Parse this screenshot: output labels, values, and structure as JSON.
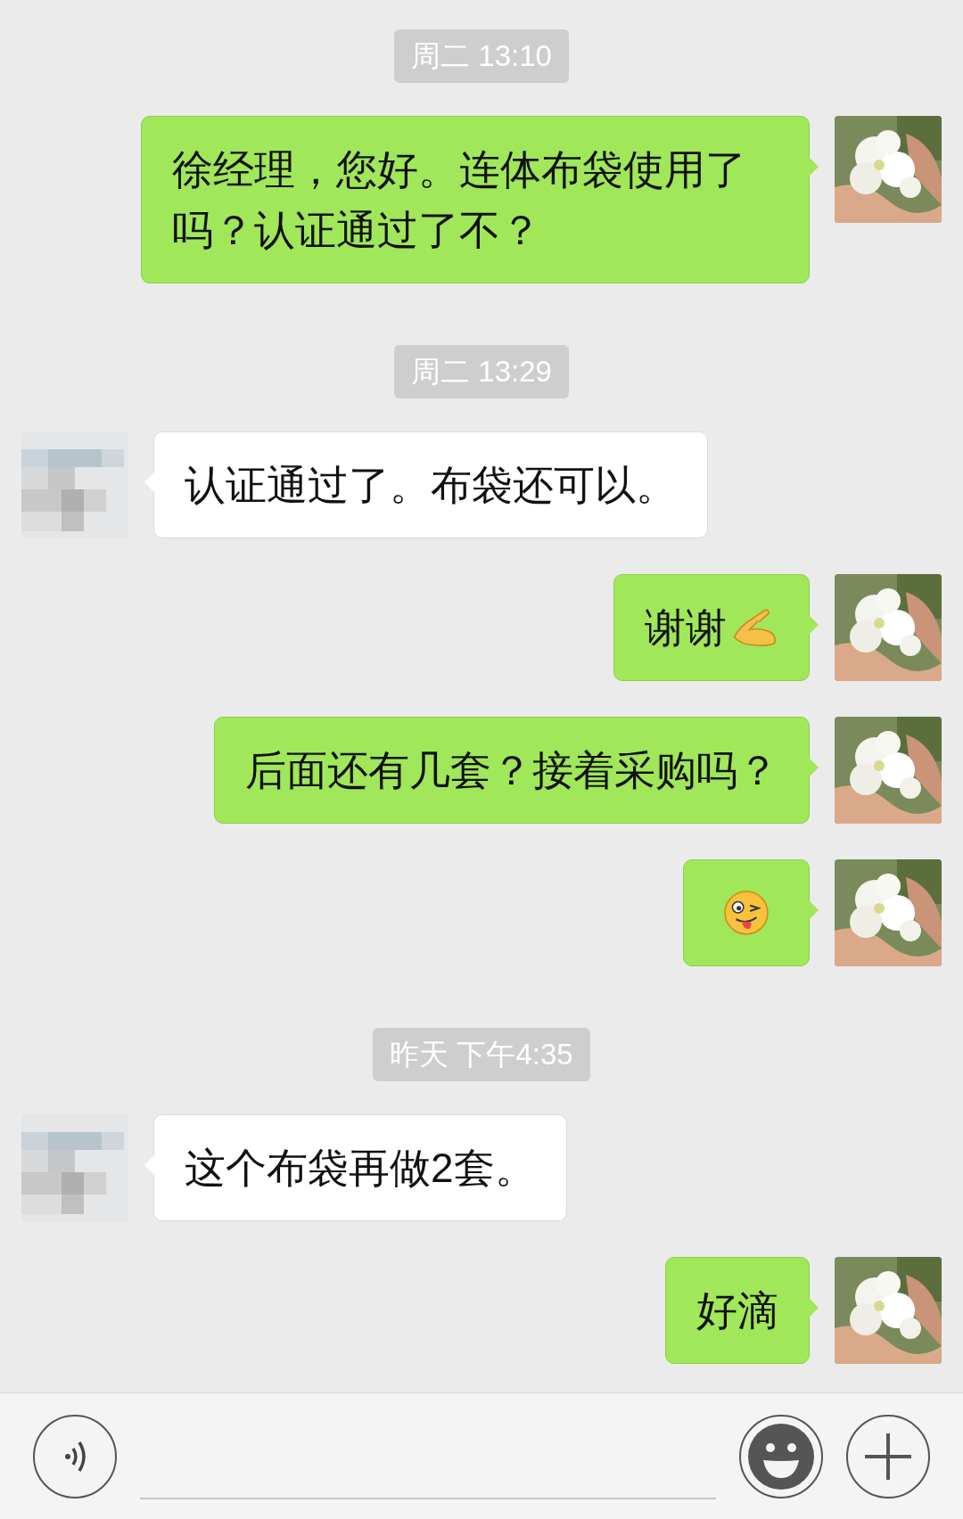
{
  "messages": [
    {
      "kind": "time",
      "text": "周二 13:10"
    },
    {
      "kind": "text",
      "outgoing": true,
      "text": "徐经理，您好。连体布袋使用了吗？认证通过了不？"
    },
    {
      "kind": "time",
      "text": "周二 13:29"
    },
    {
      "kind": "text",
      "outgoing": false,
      "text": "认证通过了。布袋还可以。"
    },
    {
      "kind": "text_emoji",
      "outgoing": true,
      "text": "谢谢"
    },
    {
      "kind": "text",
      "outgoing": true,
      "text": "后面还有几套？接着采购吗？"
    },
    {
      "kind": "emoji",
      "outgoing": true
    },
    {
      "kind": "time",
      "text": "昨天 下午4:35"
    },
    {
      "kind": "text",
      "outgoing": false,
      "text": "这个布袋再做2套。"
    },
    {
      "kind": "text",
      "outgoing": true,
      "text": "好滴"
    }
  ]
}
